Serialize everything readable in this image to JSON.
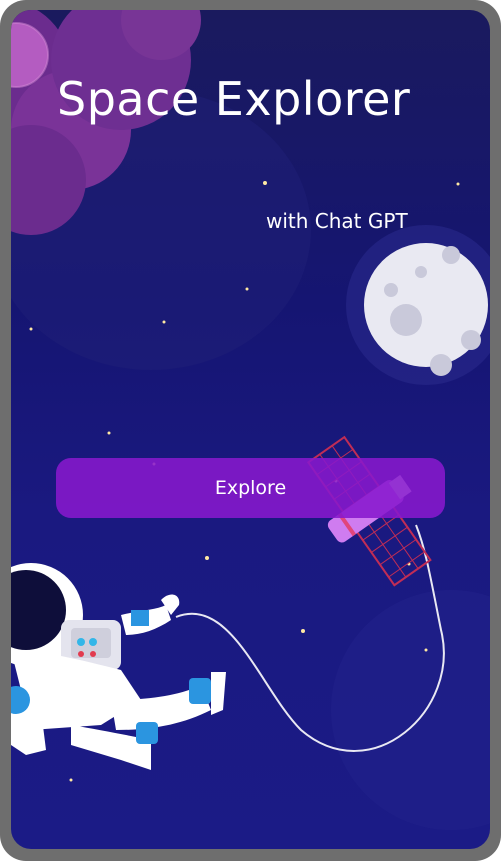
{
  "app": {
    "title": "Space Explorer",
    "subtitle": "with Chat GPT"
  },
  "actions": {
    "explore_label": "Explore"
  },
  "icons": {
    "planet": "cloud-planet-icon",
    "moon": "moon-icon",
    "satellite": "satellite-icon",
    "astronaut": "astronaut-icon"
  },
  "colors": {
    "background": "#15156e",
    "button": "#8718cd",
    "frame": "#6e6e6e",
    "text": "#ffffff"
  }
}
